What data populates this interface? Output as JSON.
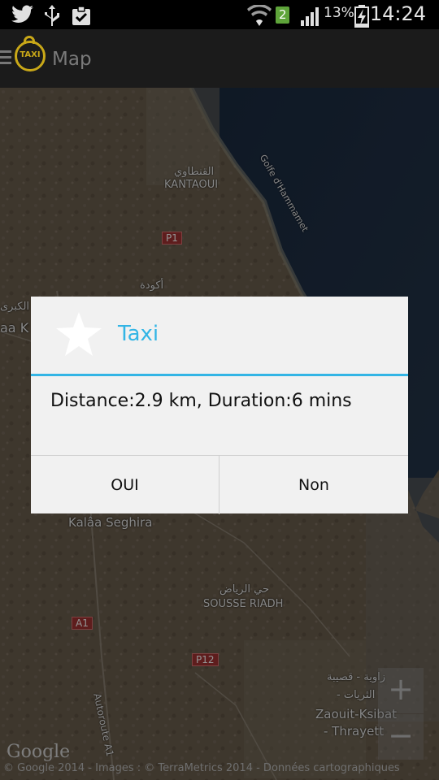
{
  "status_bar": {
    "icons": [
      "twitter-icon",
      "usb-icon",
      "clipboard-icon",
      "wifi-icon",
      "sim-icon",
      "signal-icon",
      "battery-charging-icon"
    ],
    "sim_number": "2",
    "battery": "13%",
    "time": "14:24"
  },
  "action_bar": {
    "logo_text": "TAXI",
    "title": "Map"
  },
  "map": {
    "labels": {
      "kantaoui_ar": "القنطاوي",
      "kantaoui": "KANTAOUI",
      "golfe": "Golfe d'Hammamet",
      "kouda_ar": "أكودة",
      "kalaa_kebira_ar": "القلعة الكبرى",
      "kalaa_kebira": "aa K",
      "kalaa_seghira": "Kalâa Seghira",
      "sousse_riadh_ar": "حي الرياض",
      "sousse_riadh": "SOUSSE RIADH",
      "zaouit_ar1": "زاوية - قصيبة",
      "zaouit_ar2": "- الثريات",
      "zaouit1": "Zaouit-Ksibat",
      "zaouit2": "- Thrayett",
      "autoroute": "Autoroute A1"
    },
    "roads": [
      "P1",
      "A1",
      "P12"
    ],
    "zoom_in": "+",
    "zoom_out": "−",
    "google": "Google",
    "attribution": "© Google 2014 - Images : © TerraMetrics 2014 - Données cartographiques"
  },
  "dialog": {
    "icon": "star-icon",
    "title": "Taxi",
    "message": "Distance:2.9 km, Duration:6 mins",
    "positive_button": "OUI",
    "negative_button": "Non"
  },
  "colors": {
    "accent": "#33b5e5",
    "logo": "#c9a818",
    "dialog_bg": "#f1f1f1",
    "action_bar": "#1b1b1b",
    "sea": "#1a2a40",
    "land": "#6b5f4e"
  }
}
